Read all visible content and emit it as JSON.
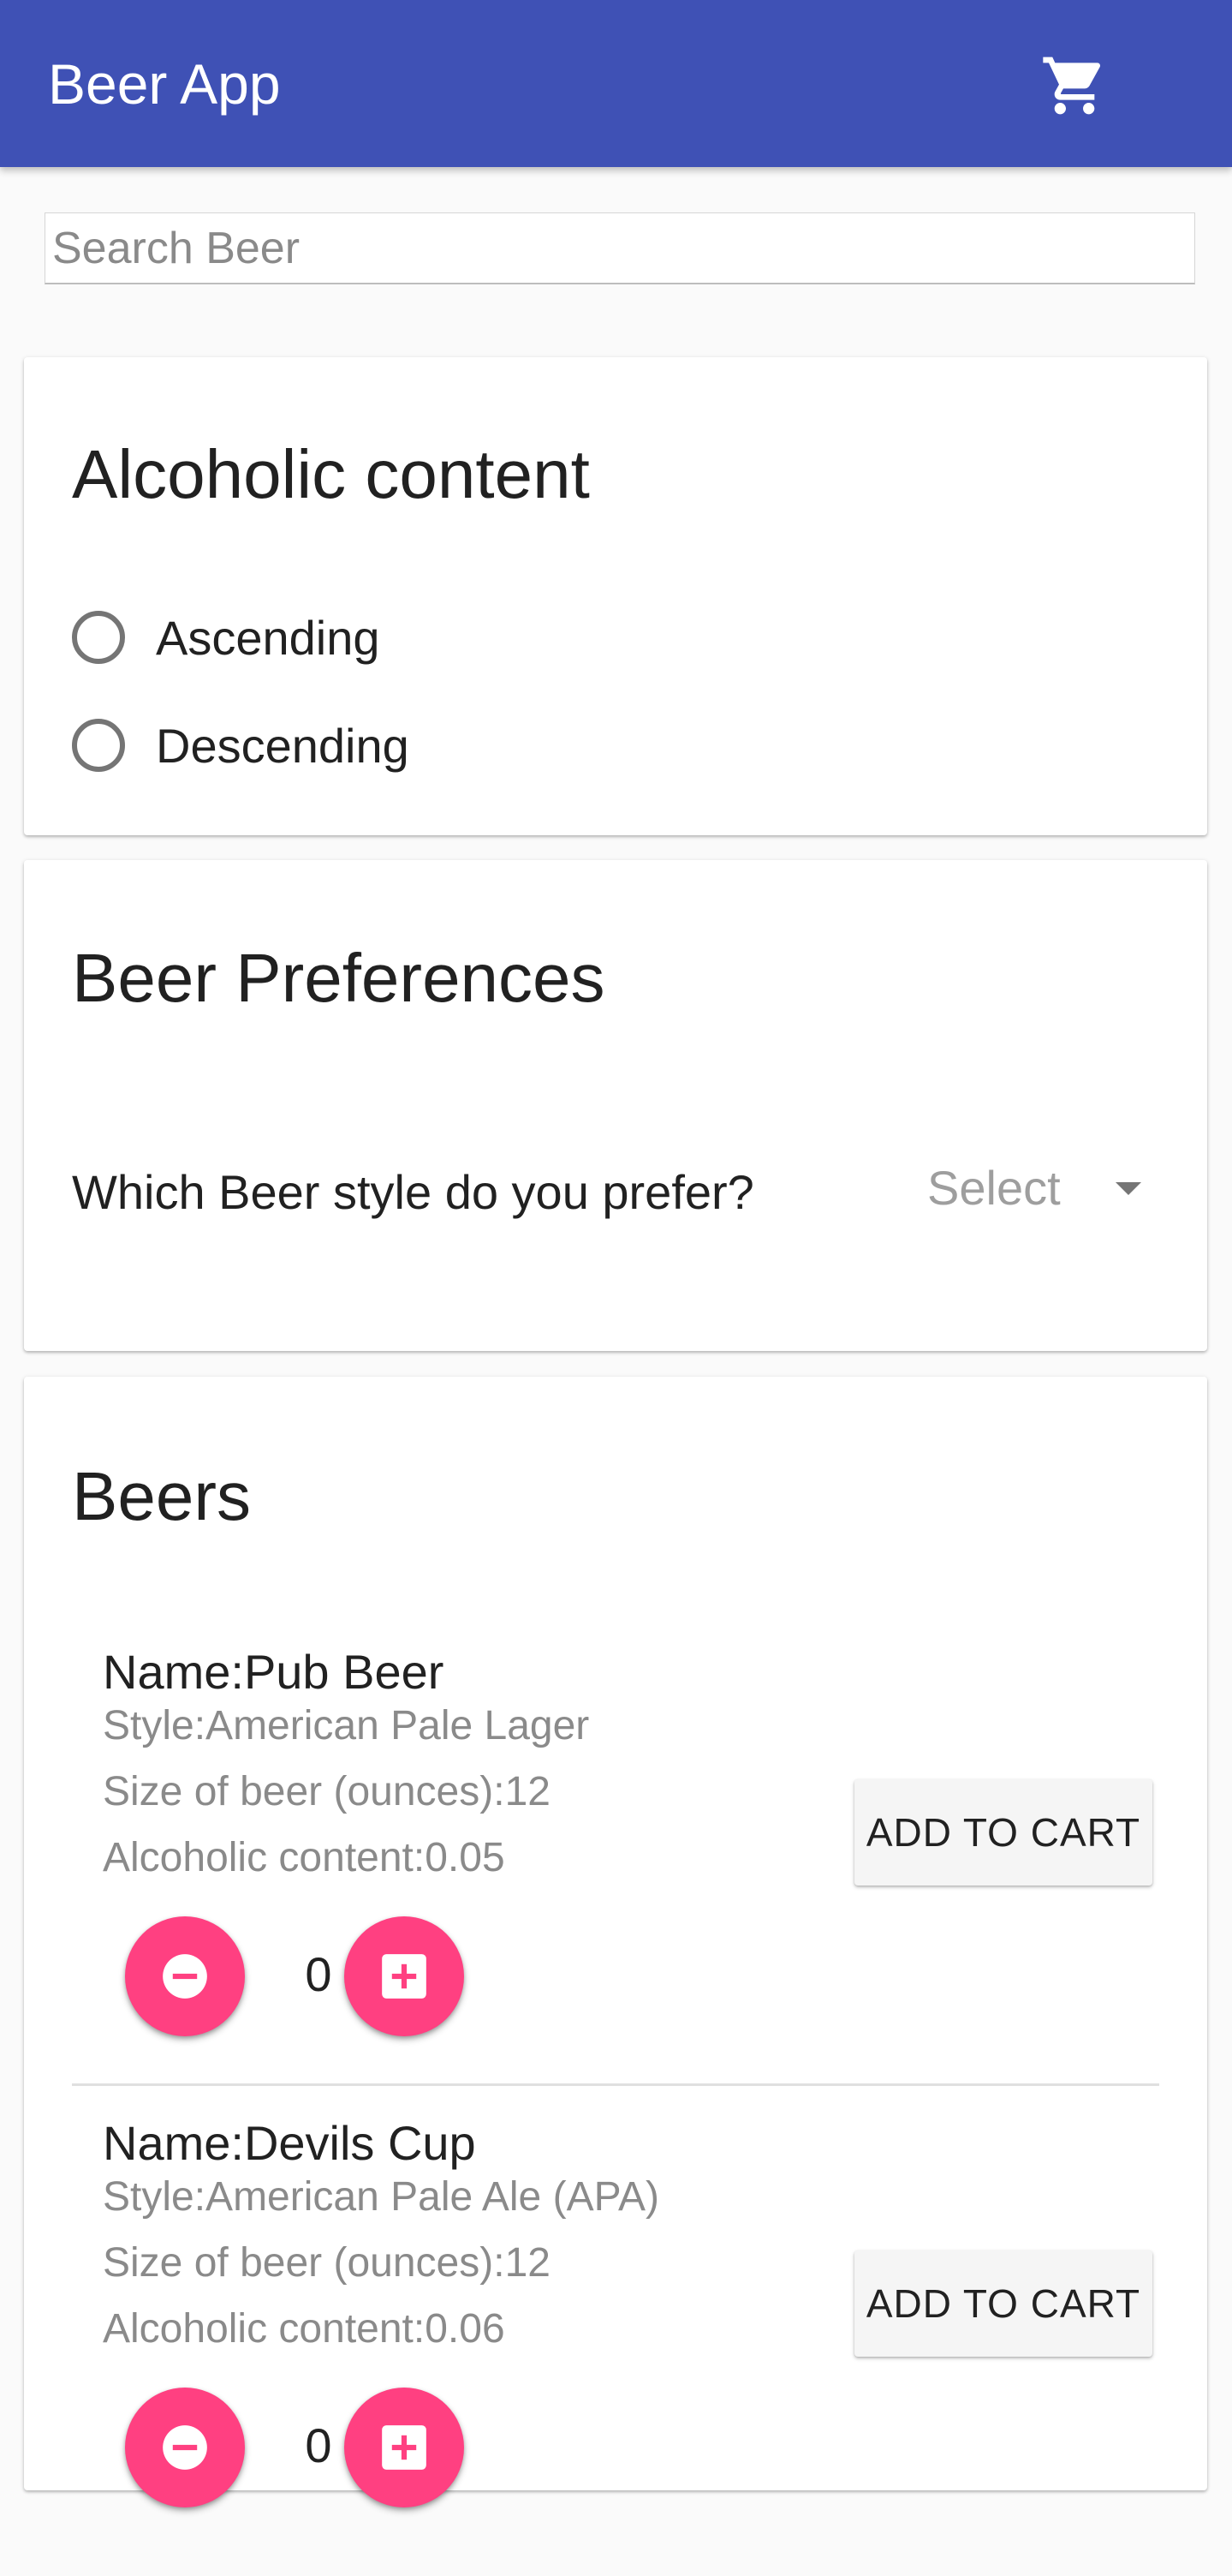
{
  "app": {
    "title": "Beer App",
    "cart_icon": "shopping-cart-icon"
  },
  "search": {
    "placeholder": "Search Beer",
    "value": ""
  },
  "sort_card": {
    "title": "Alcoholic content",
    "options": [
      {
        "label": "Ascending",
        "selected": false
      },
      {
        "label": "Descending",
        "selected": false
      }
    ]
  },
  "pref_card": {
    "title": "Beer Preferences",
    "question": "Which Beer style do you prefer?",
    "select_value": "Select"
  },
  "beers_card": {
    "title": "Beers",
    "add_label": "ADD TO CART",
    "items": [
      {
        "name": "Name:Pub Beer",
        "style": "Style:American Pale Lager",
        "size": "Size of beer (ounces):12",
        "abv": "Alcoholic content:0.05",
        "qty": "0"
      },
      {
        "name": "Name:Devils Cup",
        "style": "Style:American Pale Ale (APA)",
        "size": "Size of beer (ounces):12",
        "abv": "Alcoholic content:0.06",
        "qty": "0"
      }
    ]
  },
  "colors": {
    "primary": "#3f51b5",
    "accent": "#ff4081",
    "background": "#fafafa"
  }
}
